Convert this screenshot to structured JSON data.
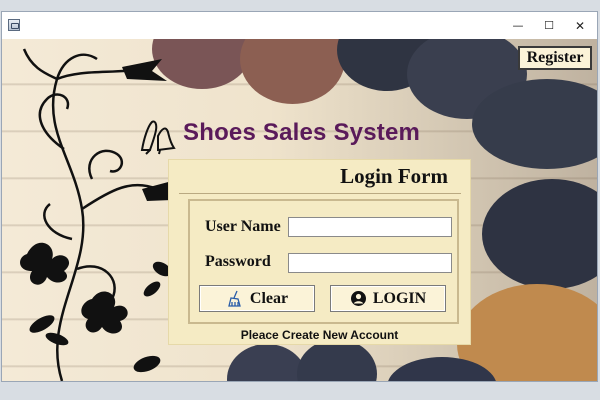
{
  "window": {
    "title": ""
  },
  "icons": {
    "app": "java-cup-icon",
    "minimize": "minimize-icon",
    "maximize": "maximize-icon",
    "close": "close-icon",
    "shoe": "high-heel-shoe-icon",
    "clear": "broom-icon",
    "login": "user-circle-icon"
  },
  "header": {
    "register_label": "Register",
    "app_title": "Shoes Sales System"
  },
  "login_form": {
    "title": "Login Form",
    "username_label": "User Name",
    "username_value": "",
    "password_label": "Password",
    "password_value": "",
    "clear_label": "Clear",
    "login_label": "LOGIN",
    "footer_message": "Pleace Create New Account"
  },
  "colors": {
    "title_purple": "#5a1a5a",
    "panel_bg": "#f5ebc4",
    "button_bg": "#fbf3d8"
  }
}
